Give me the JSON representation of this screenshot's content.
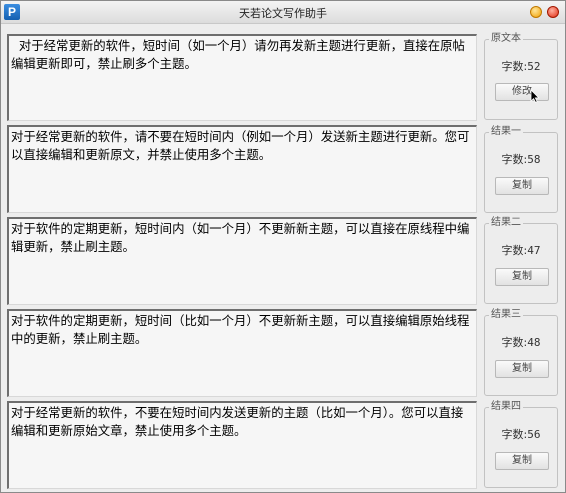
{
  "window": {
    "title": "天若论文写作助手",
    "icon_letter": "P"
  },
  "original": {
    "text": "  对于经常更新的软件，短时间（如一个月）请勿再发新主题进行更新，直接在原帖编辑更新即可，禁止刷多个主题。",
    "group_label": "原文本",
    "count_label": "字数:",
    "count": "52",
    "button_label": "修改"
  },
  "results": [
    {
      "text": "对于经常更新的软件，请不要在短时间内（例如一个月）发送新主题进行更新。您可以直接编辑和更新原文，并禁止使用多个主题。",
      "group_label": "结果一",
      "count_label": "字数:",
      "count": "58",
      "button_label": "复制"
    },
    {
      "text": "对于软件的定期更新，短时间内（如一个月）不更新新主题，可以直接在原线程中编辑更新，禁止刷主题。",
      "group_label": "结果二",
      "count_label": "字数:",
      "count": "47",
      "button_label": "复制"
    },
    {
      "text": "对于软件的定期更新，短时间（比如一个月）不更新新主题，可以直接编辑原始线程中的更新，禁止刷主题。",
      "group_label": "结果三",
      "count_label": "字数:",
      "count": "48",
      "button_label": "复制"
    },
    {
      "text": "对于经常更新的软件，不要在短时间内发送更新的主题（比如一个月）。您可以直接编辑和更新原始文章，禁止使用多个主题。",
      "group_label": "结果四",
      "count_label": "字数:",
      "count": "56",
      "button_label": "复制"
    }
  ]
}
